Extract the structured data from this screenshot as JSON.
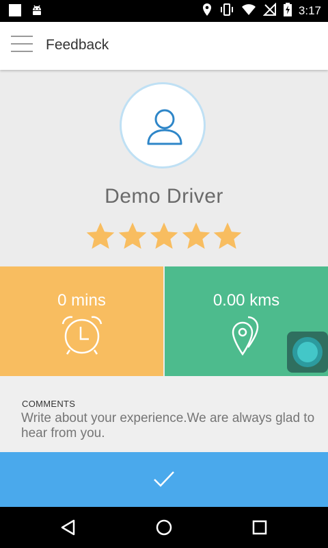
{
  "status_bar": {
    "time": "3:17",
    "left_icons": [
      "square-notification-icon",
      "android-icon"
    ],
    "right_icons": [
      "location-icon",
      "vibrate-icon",
      "wifi-icon",
      "no-signal-icon",
      "battery-charging-icon"
    ]
  },
  "app_bar": {
    "title": "Feedback",
    "menu_icon": "hamburger-menu-icon"
  },
  "driver": {
    "name": "Demo Driver",
    "avatar_icon": "user-outline-icon"
  },
  "rating": {
    "value": 5,
    "max": 5,
    "color": "#f8bd60"
  },
  "stats": {
    "duration": {
      "value": "0 mins",
      "icon": "alarm-clock-icon",
      "color": "#f8bd60"
    },
    "distance": {
      "value": "0.00 kms",
      "icon": "location-pins-icon",
      "color": "#4dbb8d"
    }
  },
  "comments": {
    "label": "COMMENTS",
    "placeholder": "Write about your experience.We are always glad to hear from you."
  },
  "submit": {
    "icon": "checkmark-icon",
    "color": "#4aa9ec"
  },
  "nav_bar": {
    "buttons": [
      "back-icon",
      "home-icon",
      "recents-icon"
    ]
  }
}
